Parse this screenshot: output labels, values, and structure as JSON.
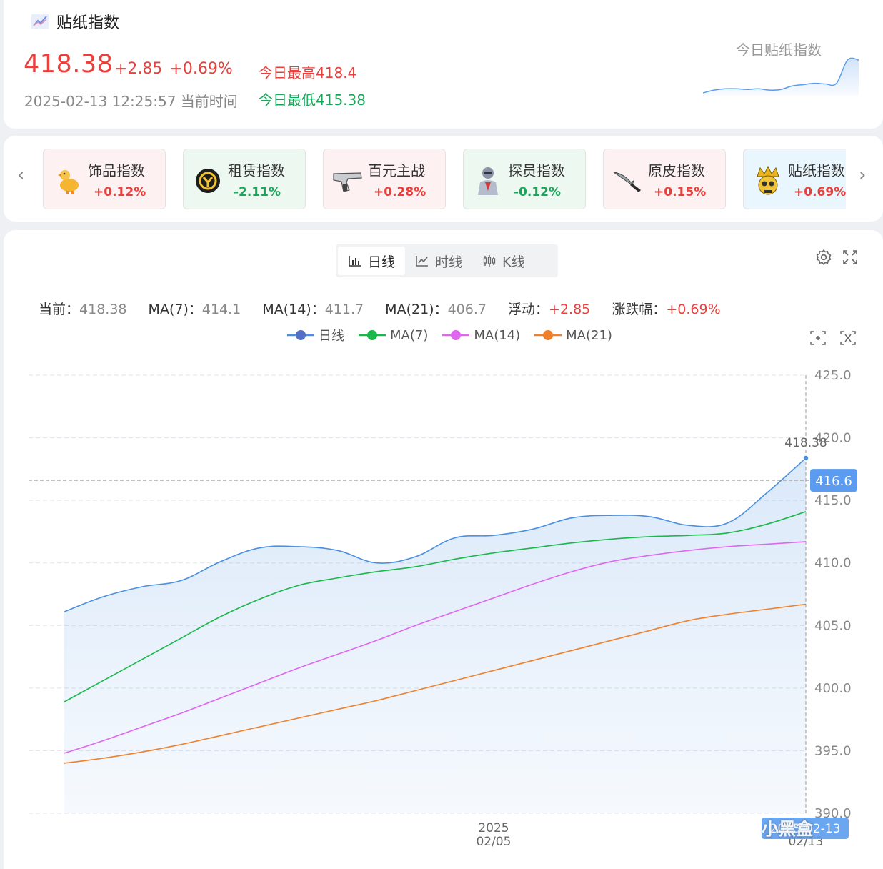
{
  "header": {
    "title": "贴纸指数",
    "price": "418.38",
    "change_abs": "+2.85",
    "change_pct": "+0.69%",
    "datetime": "2025-02-13 12:25:57 当前时间",
    "today_high": "今日最高418.4",
    "today_low": "今日最低415.38",
    "sparkline_label": "今日贴纸指数",
    "title_icon": "trend-chart-icon"
  },
  "indices": [
    {
      "name": "饰品指数",
      "change": "+0.12%",
      "trend": "up",
      "icon": "duck-icon"
    },
    {
      "name": "租赁指数",
      "change": "-2.11%",
      "trend": "down",
      "icon": "coin-logo-icon"
    },
    {
      "name": "百元主战",
      "change": "+0.28%",
      "trend": "up",
      "icon": "pistol-icon"
    },
    {
      "name": "探员指数",
      "change": "-0.12%",
      "trend": "down",
      "icon": "agent-icon"
    },
    {
      "name": "原皮指数",
      "change": "+0.15%",
      "trend": "up",
      "icon": "knife-icon"
    },
    {
      "name": "贴纸指数",
      "change": "+0.69%",
      "trend": "up",
      "icon": "crown-skull-icon"
    }
  ],
  "nav": {
    "prev_icon": "chevron-left-icon",
    "next_icon": "chevron-right-icon"
  },
  "tabs": [
    {
      "label": "日线",
      "icon": "bar-chart-icon",
      "active": true
    },
    {
      "label": "时线",
      "icon": "line-chart-icon",
      "active": false
    },
    {
      "label": "K线",
      "icon": "candlestick-icon",
      "active": false
    }
  ],
  "toolbar": {
    "settings_icon": "gear-icon",
    "fullscreen_icon": "expand-icon",
    "zoom_icon": "zoom-select-icon",
    "reset_icon": "zoom-reset-icon"
  },
  "stats": {
    "current_label": "当前：",
    "current": "418.38",
    "ma7_label": "MA(7)：",
    "ma7": "414.1",
    "ma14_label": "MA(14)：",
    "ma14": "411.7",
    "ma21_label": "MA(21)：",
    "ma21": "406.7",
    "float_label": "浮动：",
    "float": "+2.85",
    "pct_label": "涨跌幅：",
    "pct": "+0.69%"
  },
  "watermark": "小黑盒",
  "colors": {
    "red": "#e8403c",
    "green": "#19a65a",
    "daily": "#4a90e2",
    "ma7": "#19b84a",
    "ma14": "#e066f0",
    "ma21": "#f0802a"
  },
  "sparkline_data": [
    414.9,
    415.1,
    415.2,
    415.2,
    415.15,
    415.2,
    415.1,
    415.15,
    415.4,
    415.5,
    415.6,
    415.55,
    415.6,
    417.3,
    417.3
  ],
  "chart_data": {
    "type": "line",
    "x": [
      "2025-01-25",
      "2025-01-26",
      "2025-01-27",
      "2025-01-28",
      "2025-01-29",
      "2025-01-30",
      "2025-01-31",
      "2025-02-01",
      "2025-02-02",
      "2025-02-03",
      "2025-02-04",
      "2025-02-05",
      "2025-02-06",
      "2025-02-07",
      "2025-02-08",
      "2025-02-09",
      "2025-02-10",
      "2025-02-11",
      "2025-02-12",
      "2025-02-13"
    ],
    "x_tick_labels": [
      "2025\n02/05",
      "02/13"
    ],
    "series": [
      {
        "name": "日线",
        "values": [
          406.1,
          407.3,
          408.1,
          408.6,
          410.1,
          411.2,
          411.3,
          411.0,
          410.0,
          410.5,
          412.0,
          412.2,
          412.7,
          413.6,
          413.8,
          413.7,
          413.0,
          413.2,
          415.6,
          418.38
        ]
      },
      {
        "name": "MA(7)",
        "values": [
          398.9,
          400.6,
          402.3,
          404.0,
          405.7,
          407.1,
          408.2,
          408.8,
          409.3,
          409.7,
          410.3,
          410.8,
          411.2,
          411.6,
          411.9,
          412.1,
          412.2,
          412.4,
          413.1,
          414.1
        ]
      },
      {
        "name": "MA(14)",
        "values": [
          394.8,
          395.8,
          396.9,
          398.0,
          399.2,
          400.4,
          401.6,
          402.7,
          403.8,
          405.0,
          406.1,
          407.2,
          408.3,
          409.3,
          410.1,
          410.6,
          411.0,
          411.3,
          411.5,
          411.7
        ]
      },
      {
        "name": "MA(21)",
        "values": [
          394.0,
          394.4,
          394.9,
          395.5,
          396.2,
          396.9,
          397.6,
          398.3,
          399.0,
          399.8,
          400.6,
          401.4,
          402.2,
          403.0,
          403.8,
          404.6,
          405.4,
          405.9,
          406.3,
          406.7
        ]
      }
    ],
    "ylim": [
      390.0,
      425.0
    ],
    "y_ticks": [
      "425.0",
      "420.0",
      "415.0",
      "410.0",
      "405.0",
      "400.0",
      "395.0",
      "390.0"
    ],
    "crosshair_value": "416.6",
    "crosshair_date": "2025-02-13",
    "last_point_label": "418.38",
    "grid": true,
    "legend_position": "top-center"
  }
}
